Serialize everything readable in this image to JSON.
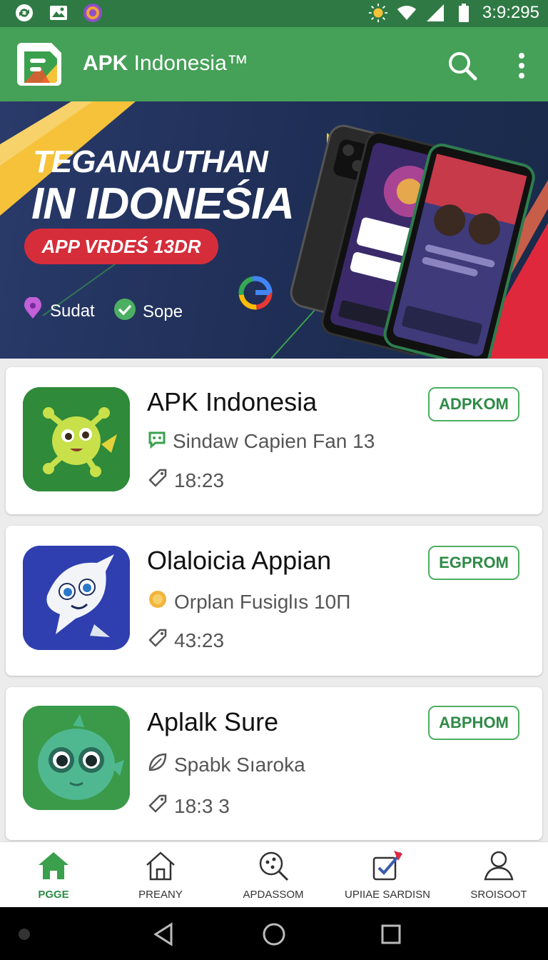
{
  "status_bar": {
    "time": "3:9:295",
    "left_icons": [
      "sync-icon",
      "gallery-icon",
      "browser-icon"
    ],
    "right_icons": [
      "brightness-icon",
      "wifi-icon",
      "signal-icon",
      "battery-icon"
    ]
  },
  "app_bar": {
    "title_bold": "APK",
    "title_rest": " Indonesia™",
    "icons": [
      "app-logo-icon",
      "search-icon",
      "more-vert-icon"
    ]
  },
  "banner": {
    "line1": "TEGANAUTHAN",
    "line2": "IN IDONEŚIA",
    "pill": "APP VRDEŚ 13DR",
    "chips": [
      {
        "label": "Sudat",
        "icon": "location-pin-icon"
      },
      {
        "label": "Sope",
        "icon": "check-circle-icon"
      }
    ]
  },
  "apps": [
    {
      "name": "APK Indonesia",
      "subtitle": "Sindaw Capien Fan 13",
      "time": "18:23",
      "button": "ADPKOM",
      "icon": "green-monster-app-icon",
      "subtitle_icon": "chat-icon"
    },
    {
      "name": "Olaloicia Appian",
      "subtitle": "Orplan Fusiglıs 10Π",
      "time": "43:23",
      "button": "EGPROM",
      "icon": "white-fish-app-icon",
      "subtitle_icon": "coin-icon"
    },
    {
      "name": "Aplalk Sure",
      "subtitle": "Spabk Sıaroka",
      "time": "18:3 3",
      "button": "ABPHOM",
      "icon": "green-blob-app-icon",
      "subtitle_icon": "leaf-icon"
    }
  ],
  "bottom_nav": [
    {
      "label": "PGGE",
      "icon": "home-filled-icon",
      "active": true
    },
    {
      "label": "PREANY",
      "icon": "home-outline-icon",
      "active": false
    },
    {
      "label": "APDASSOM",
      "icon": "search-discover-icon",
      "active": false
    },
    {
      "label": "UPIIAE SARDISN",
      "icon": "update-check-icon",
      "active": false
    },
    {
      "label": "SROISOOT",
      "icon": "profile-icon",
      "active": false
    }
  ],
  "colors": {
    "status_bar": "#2f7a44",
    "app_bar": "#45a058",
    "accent": "#4caf62",
    "banner_bg": "#1e2e55",
    "banner_pill": "#d62d3a",
    "banner_stripe_yellow": "#f5c23a",
    "banner_stripe_red": "#e0283c"
  }
}
